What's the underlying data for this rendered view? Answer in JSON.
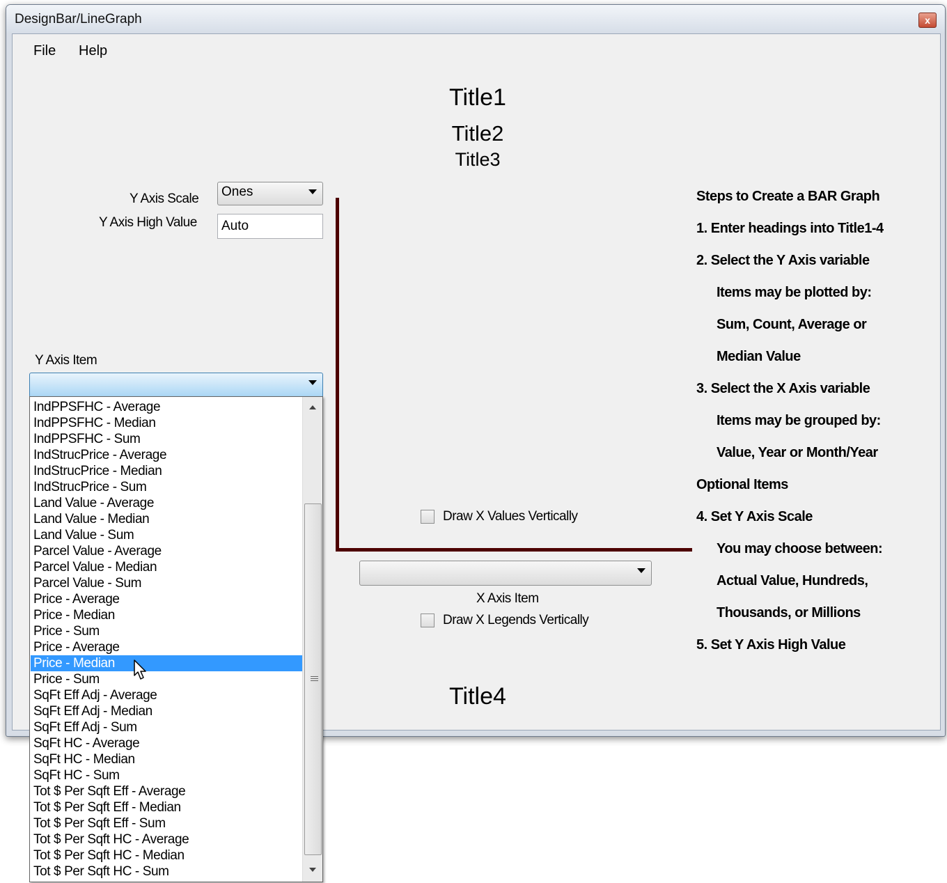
{
  "window": {
    "title": "DesignBar/LineGraph",
    "close_glyph": "x"
  },
  "menu": {
    "file": "File",
    "help": "Help"
  },
  "titles": {
    "title1": "Title1",
    "title2": "Title2",
    "title3": "Title3",
    "title4": "Title4"
  },
  "y_axis": {
    "scale_label": "Y Axis Scale",
    "scale_value": "Ones",
    "high_label": "Y Axis High Value",
    "high_value": "Auto",
    "item_label": "Y Axis Item",
    "item_value": ""
  },
  "x_axis": {
    "draw_values_label": "Draw X Values Vertically",
    "item_value": "",
    "item_label": "X Axis Item",
    "draw_legends_label": "Draw X Legends Vertically"
  },
  "steps": [
    "Steps to Create a BAR Graph",
    "1.  Enter headings into Title1-4",
    "2.  Select the Y Axis variable",
    "Items may be plotted by:",
    "Sum, Count, Average or",
    "Median Value",
    "3.  Select the X Axis variable",
    "Items may be grouped by:",
    "Value, Year or Month/Year",
    "Optional Items",
    "4.  Set Y Axis Scale",
    "You may choose between:",
    "Actual Value, Hundreds,",
    "Thousands, or Millions",
    "5.  Set Y Axis High Value"
  ],
  "dropdown_items": [
    "IndPPSFHC - Average",
    "IndPPSFHC - Median",
    "IndPPSFHC - Sum",
    "IndStrucPrice - Average",
    "IndStrucPrice - Median",
    "IndStrucPrice - Sum",
    "Land Value - Average",
    "Land Value - Median",
    "Land Value - Sum",
    "Parcel Value - Average",
    "Parcel Value - Median",
    "Parcel Value - Sum",
    "Price - Average",
    "Price - Median",
    "Price - Sum",
    "Price - Average",
    "Price - Median",
    "Price - Sum",
    "SqFt Eff Adj - Average",
    "SqFt Eff Adj - Median",
    "SqFt Eff Adj - Sum",
    "SqFt HC - Average",
    "SqFt HC - Median",
    "SqFt HC - Sum",
    "Tot $ Per Sqft Eff - Average",
    "Tot $ Per Sqft Eff - Median",
    "Tot $ Per Sqft Eff - Sum",
    "Tot $ Per Sqft HC - Average",
    "Tot $ Per Sqft HC - Median",
    "Tot $ Per Sqft HC - Sum"
  ],
  "selected_index": 16,
  "colors": {
    "axis": "#4d0000",
    "selection": "#3399ff"
  }
}
